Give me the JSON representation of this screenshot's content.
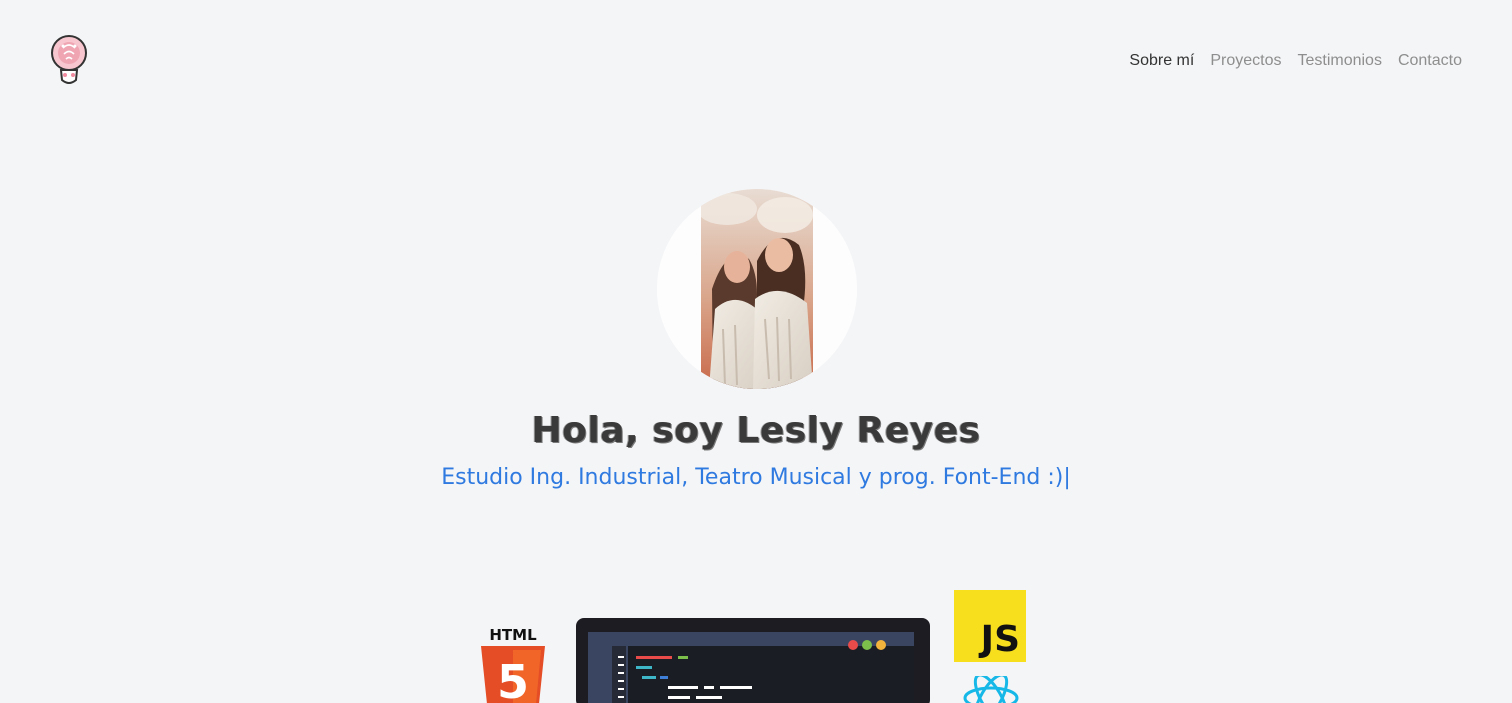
{
  "header": {
    "logo_icon": "lightbulb-brain-logo",
    "nav": [
      {
        "label": "Sobre mí",
        "active": true
      },
      {
        "label": "Proyectos",
        "active": false
      },
      {
        "label": "Testimonios",
        "active": false
      },
      {
        "label": "Contacto",
        "active": false
      }
    ]
  },
  "hero": {
    "title": "Hola, soy Lesly Reyes",
    "subtitle": "Estudio Ing. Industrial, Teatro Musical y prog. Font-End :)",
    "cursor": "|"
  },
  "illustration": {
    "html_label": "HTML",
    "html_number": "5",
    "js_label": "JS"
  },
  "colors": {
    "background": "#f4f5f7",
    "accent": "#2f7ae0",
    "html_orange": "#e44d26",
    "js_yellow": "#f7df1e",
    "react_cyan": "#16b8e8"
  }
}
